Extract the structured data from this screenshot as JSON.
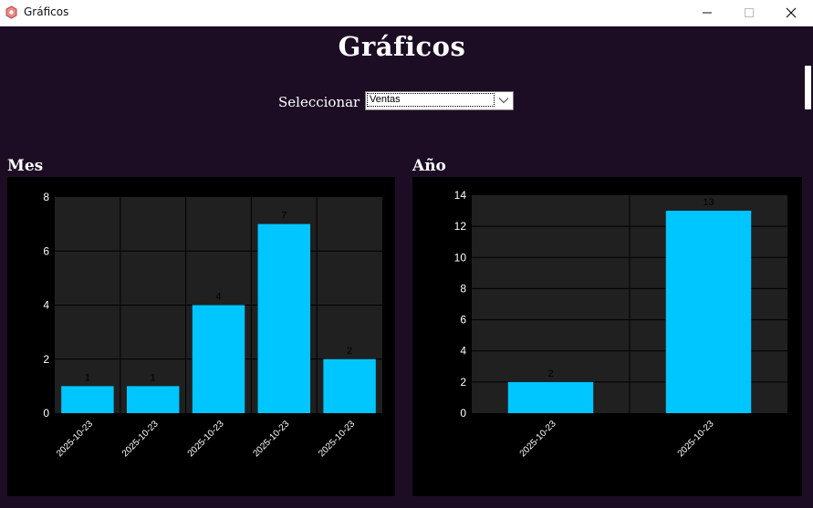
{
  "window": {
    "title": "Gráficos",
    "controls": [
      "minimize-icon",
      "maximize-icon",
      "close-icon"
    ]
  },
  "page": {
    "title": "Gráficos",
    "select_label": "Seleccionar",
    "select_value": "Ventas"
  },
  "colors": {
    "background": "#1c0d24",
    "panel": "#000000",
    "plot_area": "#202020",
    "bar": "#00c6ff",
    "grid": "#000000",
    "text": "#ffffff"
  },
  "sections": {
    "month_title": "Mes",
    "year_title": "Año"
  },
  "chart_data": [
    {
      "type": "bar",
      "title": "Mes",
      "categories": [
        "2025-10-23",
        "2025-10-23",
        "2025-10-23",
        "2025-10-23",
        "2025-10-23"
      ],
      "values": [
        1,
        1,
        4,
        7,
        2
      ],
      "ylim": [
        0,
        8
      ],
      "yticks": [
        0,
        2,
        4,
        6,
        8
      ],
      "grid": true,
      "data_labels": true
    },
    {
      "type": "bar",
      "title": "Año",
      "categories": [
        "2025-10-23",
        "2025-10-23"
      ],
      "values": [
        2,
        13
      ],
      "ylim": [
        0,
        14
      ],
      "yticks": [
        0,
        2,
        4,
        6,
        8,
        10,
        12,
        14
      ],
      "grid": true,
      "data_labels": true
    }
  ]
}
